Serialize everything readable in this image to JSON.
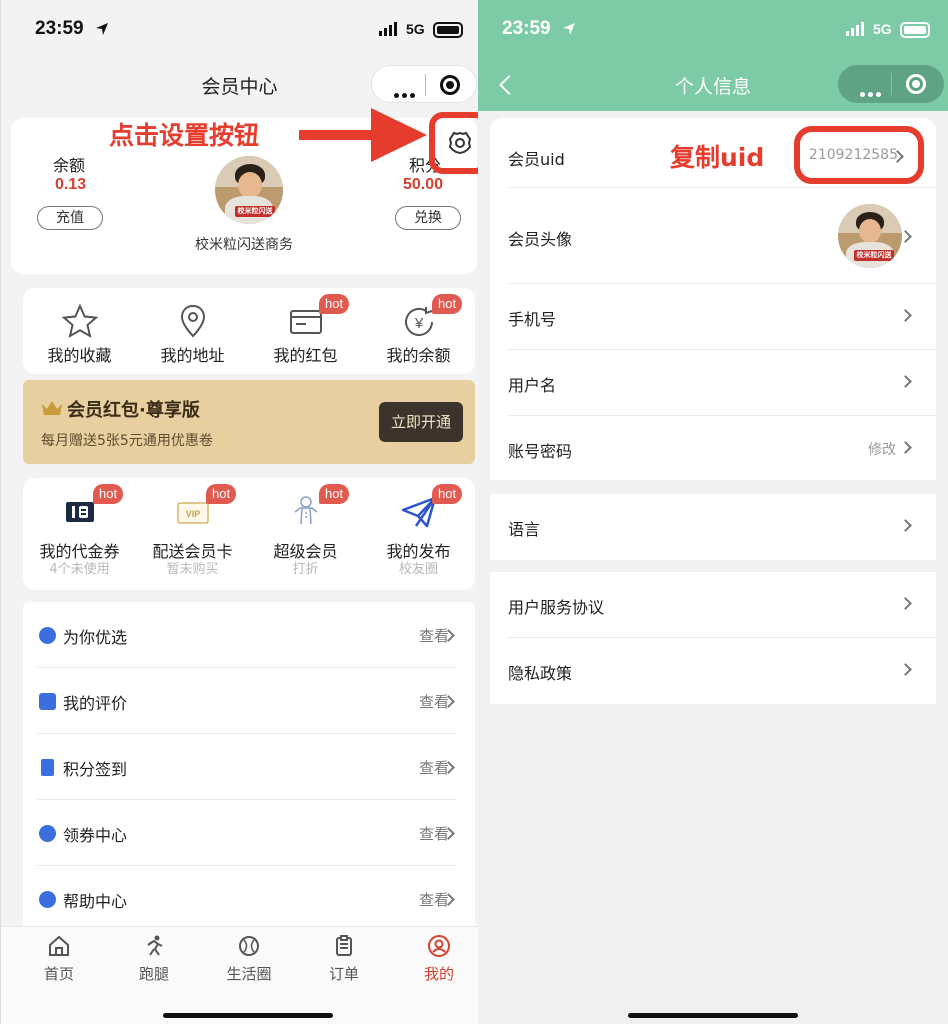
{
  "left": {
    "status_bar": {
      "time": "23:59",
      "network": "5G"
    },
    "nav_title": "会员中心",
    "balance": {
      "label": "余额",
      "value": "0.13",
      "button": "充值"
    },
    "points": {
      "label": "积分",
      "value": "50.00",
      "button": "兑换"
    },
    "merchant_name": "校米粒闪送商务",
    "avatar_badge": "校米粒闪送",
    "annotation_text": "点击设置按钮",
    "quick_actions": [
      {
        "label": "我的收藏",
        "icon": "star-icon"
      },
      {
        "label": "我的地址",
        "icon": "location-pin-icon"
      },
      {
        "label": "我的红包",
        "icon": "red-packet-icon",
        "hot": "hot"
      },
      {
        "label": "我的余额",
        "icon": "balance-coin-icon",
        "hot": "hot"
      }
    ],
    "banner": {
      "title": "会员红包·尊享版",
      "subtitle": "每月赠送5张5元通用优惠卷",
      "button": "立即开通"
    },
    "services": [
      {
        "label": "我的代金券",
        "sub": "4个未使用",
        "icon": "voucher-icon",
        "hot": "hot"
      },
      {
        "label": "配送会员卡",
        "sub": "暂未购买",
        "icon": "vip-card-icon",
        "hot": "hot"
      },
      {
        "label": "超级会员",
        "sub": "打折",
        "icon": "gingerbread-icon",
        "hot": "hot"
      },
      {
        "label": "我的发布",
        "sub": "校友圈",
        "icon": "paper-plane-icon",
        "hot": "hot"
      }
    ],
    "menu": [
      {
        "label": "为你优选",
        "action": "查看",
        "icon": "recommend-icon"
      },
      {
        "label": "我的评价",
        "action": "查看",
        "icon": "comment-icon"
      },
      {
        "label": "积分签到",
        "action": "查看",
        "icon": "bookmark-icon"
      },
      {
        "label": "领券中心",
        "action": "查看",
        "icon": "coupon-center-icon"
      },
      {
        "label": "帮助中心",
        "action": "查看",
        "icon": "help-icon"
      }
    ],
    "tabs": [
      {
        "label": "首页",
        "icon": "home-icon"
      },
      {
        "label": "跑腿",
        "icon": "runner-icon"
      },
      {
        "label": "生活圈",
        "icon": "life-circle-icon"
      },
      {
        "label": "订单",
        "icon": "order-icon"
      },
      {
        "label": "我的",
        "icon": "profile-icon",
        "active": true
      }
    ]
  },
  "right": {
    "status_bar": {
      "time": "23:59",
      "network": "5G"
    },
    "nav_title": "个人信息",
    "annotation_text": "复制uid",
    "rows": [
      {
        "label": "会员uid",
        "value": "2109212585"
      },
      {
        "label": "会员头像"
      },
      {
        "label": "手机号"
      },
      {
        "label": "用户名"
      },
      {
        "label": "账号密码",
        "value": "修改"
      }
    ],
    "rows2": [
      {
        "label": "语言"
      }
    ],
    "rows3": [
      {
        "label": "用户服务协议"
      },
      {
        "label": "隐私政策"
      }
    ],
    "avatar_badge": "校米粒闪送"
  },
  "colors": {
    "accent_red": "#d5412f",
    "annotation_red": "#e53c2e",
    "header_green": "#7ccba6",
    "banner_gold": "#e8cf9f"
  }
}
